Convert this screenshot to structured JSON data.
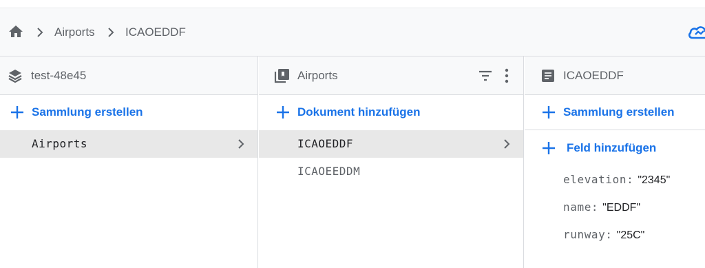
{
  "breadcrumb": {
    "items": [
      "Airports",
      "ICAOEDDF"
    ]
  },
  "panels": {
    "root": {
      "title": "test-48e45",
      "action_label": "Sammlung erstellen",
      "items": [
        {
          "label": "Airports",
          "selected": true
        }
      ]
    },
    "collection": {
      "title": "Airports",
      "action_label": "Dokument hinzufügen",
      "items": [
        {
          "label": "ICAOEDDF",
          "selected": true
        },
        {
          "label": "ICAOEEDDM",
          "selected": false
        }
      ]
    },
    "document": {
      "title": "ICAOEDDF",
      "action_label": "Sammlung erstellen",
      "add_field_label": "Feld hinzufügen",
      "fields": [
        {
          "key": "elevation:",
          "value": "\"2345\""
        },
        {
          "key": "name:",
          "value": "\"EDDF\""
        },
        {
          "key": "runway:",
          "value": "\"25C\""
        }
      ]
    }
  },
  "colors": {
    "accent": "#1a73e8",
    "selected_row": "#e8e8e8",
    "header_bg": "#f8f9fa",
    "border": "#dadce0",
    "text_secondary": "#5f6368"
  },
  "icons": {
    "home": "home-icon",
    "cloud": "cloud-icon",
    "database": "database-icon",
    "collection": "collection-icon",
    "document": "document-icon",
    "filter": "filter-icon",
    "more": "more-vert-icon",
    "chevron": "chevron-right-icon",
    "plus": "plus-icon"
  }
}
